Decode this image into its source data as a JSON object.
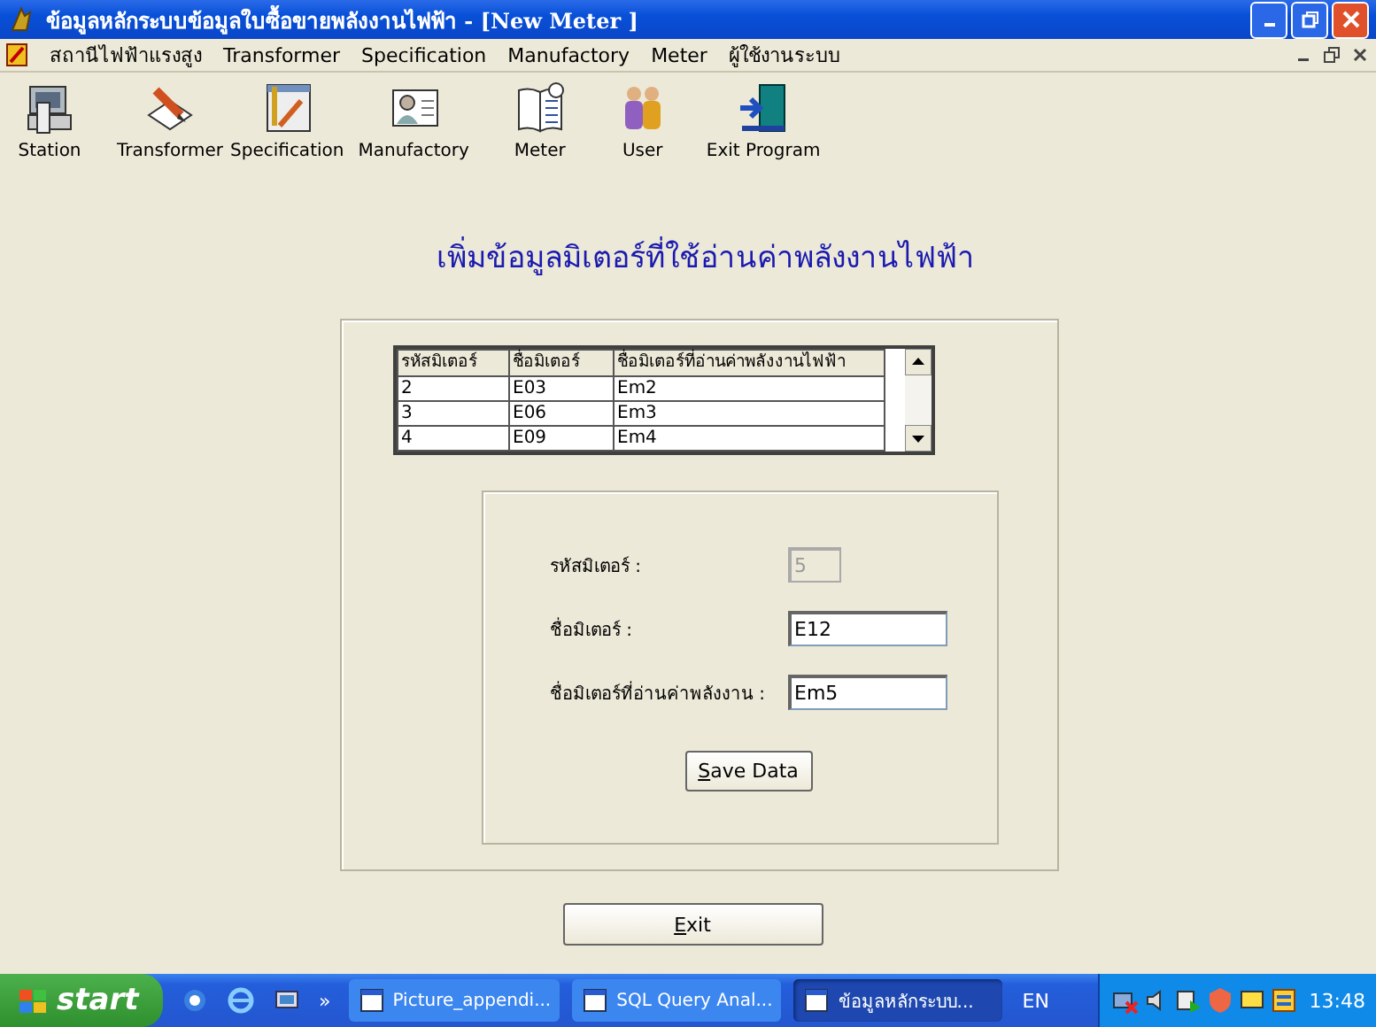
{
  "window": {
    "title": "ข้อมูลหลักระบบข้อมูลใบซื้อขายพลังงานไฟฟ้า - [New Meter ]"
  },
  "menu": [
    "สถานีไฟฟ้าแรงสูง",
    "Transformer",
    "Specification",
    "Manufactory",
    "Meter",
    "ผู้ใช้งานระบบ"
  ],
  "toolbar": [
    {
      "label": "Station",
      "kind": "station"
    },
    {
      "label": "Transformer",
      "kind": "transformer"
    },
    {
      "label": "Specification",
      "kind": "specification"
    },
    {
      "label": "Manufactory",
      "kind": "manufactory"
    },
    {
      "label": "Meter",
      "kind": "meter"
    },
    {
      "label": "User",
      "kind": "user"
    },
    {
      "label": "Exit Program",
      "kind": "exit"
    }
  ],
  "heading": "เพิ่มข้อมูลมิเตอร์ที่ใช้อ่านค่าพลังงานไฟฟ้า",
  "table": {
    "columns": [
      "รหัสมิเตอร์",
      "ชื่อมิเตอร์",
      "ชื่อมิเตอร์ที่อ่านค่าพลังงานไฟฟ้า"
    ],
    "rows": [
      [
        "2",
        "E03",
        "Em2"
      ],
      [
        "3",
        "E06",
        "Em3"
      ],
      [
        "4",
        "E09",
        "Em4"
      ]
    ]
  },
  "form": {
    "fields": [
      {
        "label": "รหัสมิเตอร์ :",
        "value": "5",
        "disabled": true
      },
      {
        "label": "ชื่อมิเตอร์ :",
        "value": "E12",
        "disabled": false
      },
      {
        "label": "ชื่อมิเตอร์ที่อ่านค่าพลังงาน :",
        "value": "Em5",
        "disabled": false
      }
    ]
  },
  "save_button": "Save Data",
  "exit_button": "Exit",
  "taskbar": {
    "start": "start",
    "quick_launch_more": "»",
    "tasks": [
      {
        "label": "Picture_appendi...",
        "selected": false
      },
      {
        "label": "SQL Query Anal...",
        "selected": false
      },
      {
        "label": "ข้อมูลหลักระบบ...",
        "selected": true
      }
    ],
    "language": "EN",
    "clock": "13:48"
  }
}
